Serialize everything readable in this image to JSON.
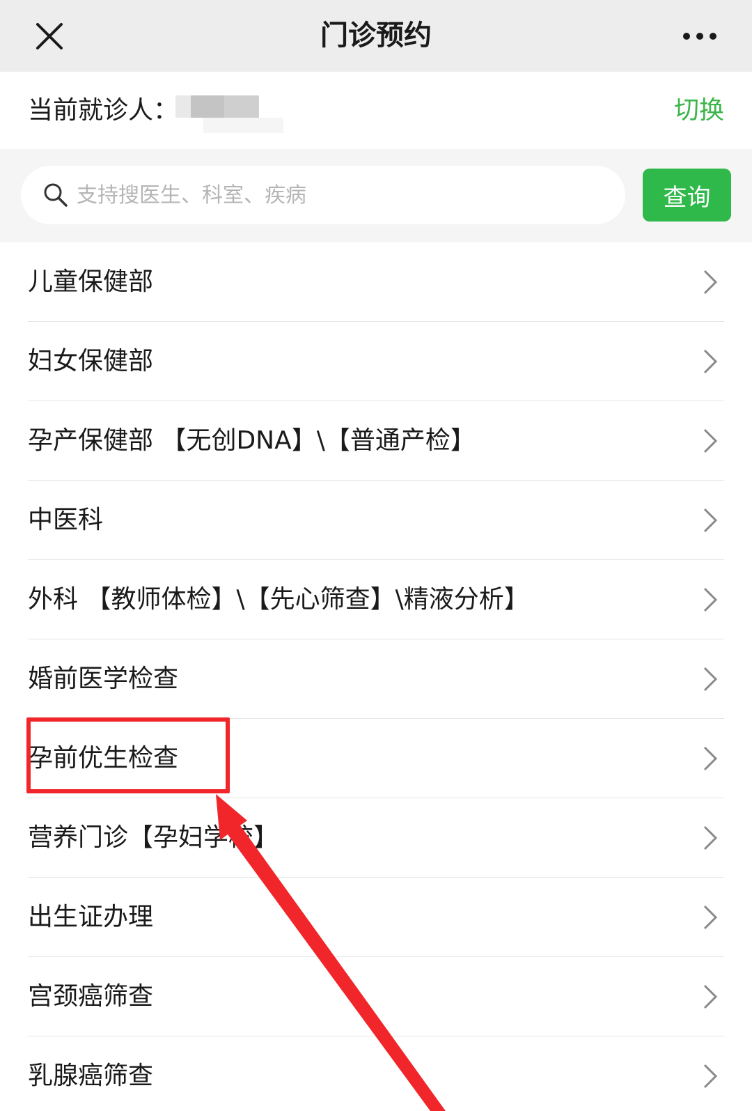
{
  "header": {
    "title": "门诊预约"
  },
  "patient": {
    "label": "当前就诊人：",
    "switch_label": "切换"
  },
  "search": {
    "placeholder": "支持搜医生、科室、疾病",
    "button_label": "查询"
  },
  "departments": [
    {
      "label": "儿童保健部"
    },
    {
      "label": "妇女保健部"
    },
    {
      "label": "孕产保健部 【无创DNA】\\【普通产检】"
    },
    {
      "label": "中医科"
    },
    {
      "label": "外科 【教师体检】\\【先心筛查】\\精液分析】"
    },
    {
      "label": "婚前医学检查"
    },
    {
      "label": "孕前优生检查"
    },
    {
      "label": "营养门诊【孕妇学校】"
    },
    {
      "label": "出生证办理"
    },
    {
      "label": "宫颈癌筛查"
    },
    {
      "label": "乳腺癌筛查"
    }
  ],
  "colors": {
    "accent_green": "#2fb94a",
    "annotation_red": "#f0262a"
  },
  "annotation": {
    "highlighted_item": "孕前优生检查",
    "icon": "arrow-pointer-icon"
  }
}
